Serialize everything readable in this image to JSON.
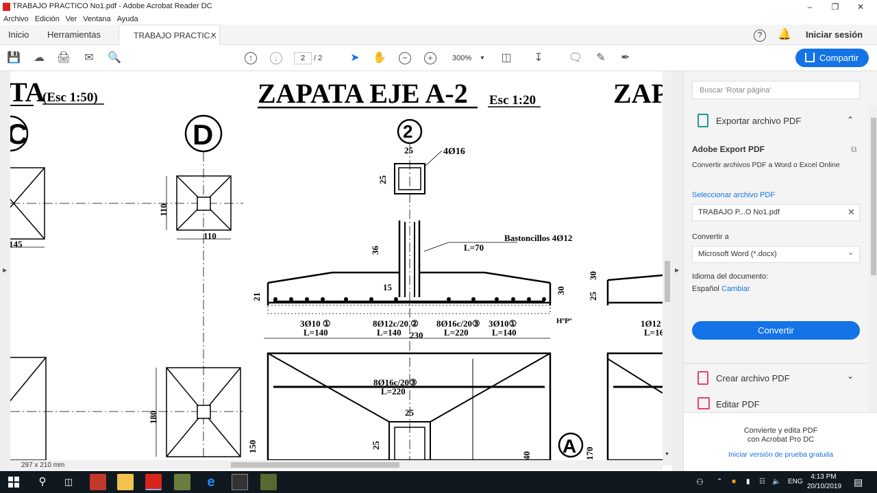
{
  "window": {
    "title": "TRABAJO PRACTICO No1.pdf - Adobe Acrobat Reader DC"
  },
  "menu": [
    "Archivo",
    "Edición",
    "Ver",
    "Ventana",
    "Ayuda"
  ],
  "tabs": {
    "home": "Inicio",
    "tools": "Herramientas",
    "document": "TRABAJO PRACTIC...",
    "signin": "Iniciar sesión"
  },
  "toolbar": {
    "page_current": "2",
    "page_total": "/ 2",
    "zoom": "300%",
    "share": "Compartir"
  },
  "document": {
    "page_size": "297 x 210 mm",
    "titles": {
      "left": "TA",
      "left_scale": "(Esc 1:50)",
      "main": "ZAPATA EJE A-2",
      "main_scale": "Esc 1:20",
      "right": "ZAP"
    },
    "axis_labels": {
      "c": "C",
      "d": "D",
      "two": "2",
      "a": "A"
    },
    "dims": {
      "d145": "145",
      "d110v": "110",
      "d110h": "110",
      "d180": "180",
      "d150": "150",
      "d25top": "25",
      "d25side": "25",
      "d36": "36",
      "d15": "15",
      "d21": "21",
      "d30": "30",
      "d230": "230",
      "d25r": "25",
      "d30r": "30",
      "d25mid": "25",
      "d25lo": "25",
      "d150v": "150",
      "d40": "40",
      "d170": "170"
    },
    "annotations": {
      "bars4": "4Ø16",
      "bastoncillos": "Bastoncillos 4Ø12",
      "l70": "L=70",
      "r1": "3Ø10 ①",
      "r1l": "L=140",
      "r2": "8Ø12c/20 ②",
      "r2l": "L=140",
      "r3": "8Ø16c/20③",
      "r3l": "L=220",
      "r4": "3Ø10①",
      "r4l": "L=140",
      "hpo": "HºPº",
      "plan": "8Ø16c/20③",
      "planl": "L=220",
      "rbar": "1Ø12",
      "rl": "L=16"
    }
  },
  "rightpane": {
    "search_placeholder": "Buscar 'Rotar página'",
    "export_title": "Exportar archivo PDF",
    "service_title": "Adobe Export PDF",
    "service_desc": "Convertir archivos PDF a Word o Excel Online",
    "select_label": "Seleccionar archivo PDF",
    "selected_file": "TRABAJO P...O No1.pdf",
    "convert_to_label": "Convertir a",
    "convert_to_value": "Microsoft Word (*.docx)",
    "doc_lang_label": "Idioma del documento:",
    "doc_lang_value": "Español",
    "change_link": "Cambiar",
    "convert_button": "Convertir",
    "create_pdf": "Crear archivo PDF",
    "edit_pdf": "Editar PDF",
    "promo_line1": "Convierte y edita PDF",
    "promo_line2": "con Acrobat Pro DC",
    "trial_link": "Iniciar versión de prueba gratuita"
  },
  "taskbar": {
    "lang": "ENG",
    "time": "4:13 PM",
    "date": "20/10/2019"
  },
  "colors": {
    "accent": "#1473e6",
    "taskbar": "#101820",
    "acrobat_red": "#d8251c"
  }
}
